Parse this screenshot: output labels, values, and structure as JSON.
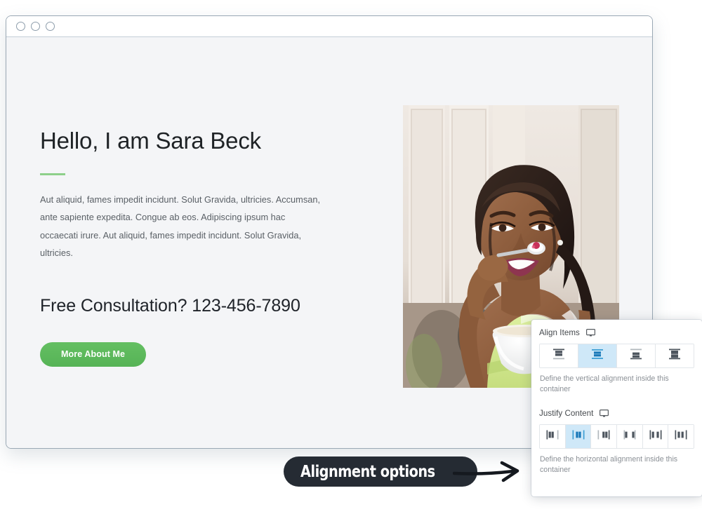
{
  "browser": {
    "window_dots": [
      "dot-red",
      "dot-yellow",
      "dot-green"
    ]
  },
  "hero": {
    "title": "Hello, I am Sara Beck",
    "body": "Aut aliquid, fames impedit incidunt. Solut Gravida, ultricies. Accumsan, ante sapiente expedita. Congue ab eos. Adipiscing ipsum hac occaecati irure. Aut aliquid, fames impedit incidunt. Solut Gravida, ultricies.",
    "subheading": "Free Consultation? 123-456-7890",
    "button_label": "More About Me",
    "accent_color": "#8ed08a",
    "button_color": "#5cb85c",
    "photo_alt": "woman holding a bowl of yogurt with berries on a spoon"
  },
  "panel": {
    "align_items": {
      "label": "Align Items",
      "device_icon": "monitor-icon",
      "help": "Define the vertical alignment inside this container",
      "selected_index": 1,
      "options": [
        {
          "name": "align-flex-start",
          "icon": "align-start-icon"
        },
        {
          "name": "align-center",
          "icon": "align-center-icon"
        },
        {
          "name": "align-flex-end",
          "icon": "align-end-icon"
        },
        {
          "name": "align-stretch",
          "icon": "align-stretch-icon"
        }
      ]
    },
    "justify_content": {
      "label": "Justify Content",
      "device_icon": "monitor-icon",
      "help": "Define the horizontal alignment inside this container",
      "selected_index": 1,
      "options": [
        {
          "name": "justify-flex-start",
          "icon": "justify-start-icon"
        },
        {
          "name": "justify-center",
          "icon": "justify-center-icon"
        },
        {
          "name": "justify-flex-end",
          "icon": "justify-end-icon"
        },
        {
          "name": "justify-space-between",
          "icon": "justify-space-between-icon"
        },
        {
          "name": "justify-space-around",
          "icon": "justify-space-around-icon"
        },
        {
          "name": "justify-space-evenly",
          "icon": "justify-space-evenly-icon"
        }
      ]
    },
    "highlight_color": "#cfe8f8"
  },
  "callout": {
    "text": "Alignment options",
    "background": "#252b33",
    "arrow_icon": "arrow-right-icon"
  }
}
